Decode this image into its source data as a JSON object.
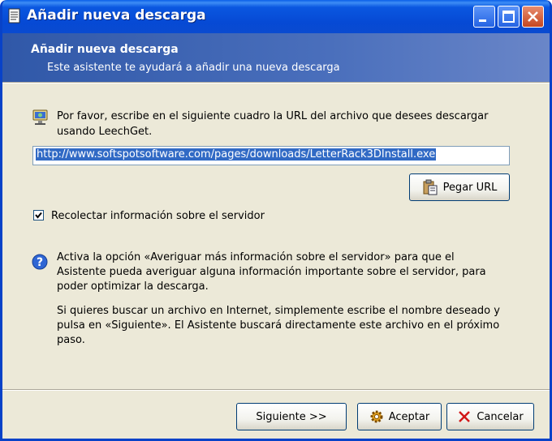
{
  "window": {
    "title": "Añadir nueva descarga"
  },
  "header": {
    "title": "Añadir nueva descarga",
    "subtitle": "Este asistente te ayudará a añadir una nueva descarga"
  },
  "url_section": {
    "instructions_line1": "Por favor, escribe en el siguiente cuadro la URL del archivo que desees descargar",
    "instructions_line2": "usando LeechGet.",
    "url_value": "http://www.softspotsoftware.com/pages/downloads/LetterRack3DInstall.exe",
    "paste_button": "Pegar URL"
  },
  "checkbox": {
    "label": "Recolectar información sobre el servidor",
    "checked": true
  },
  "help": {
    "para1_line1": "Activa la opción «Averiguar más información sobre el servidor» para que el",
    "para1_line2": "Asistente pueda averiguar alguna información importante sobre el servidor, para",
    "para1_line3": "poder optimizar la descarga.",
    "para2_line1": "Si quieres buscar un archivo en Internet, simplemente escribe el nombre deseado y",
    "para2_line2": "pulsa en «Siguiente». El Asistente buscará directamente este archivo en el próximo",
    "para2_line3": "paso."
  },
  "buttons": {
    "next": "Siguiente >>",
    "accept": "Aceptar",
    "cancel": "Cancelar"
  },
  "colors": {
    "titlebar": "#0a57e0",
    "header": "#3058a8",
    "face": "#ece9d8",
    "selection": "#316ac5"
  }
}
